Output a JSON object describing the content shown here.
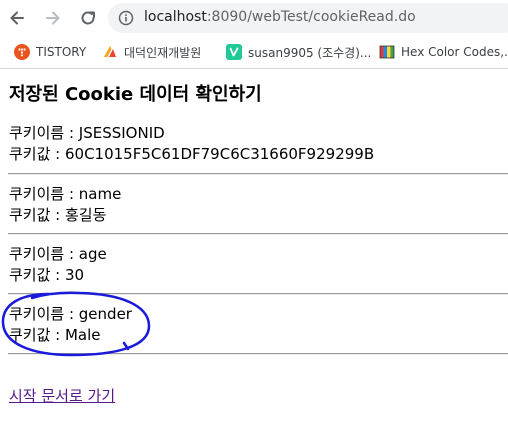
{
  "browser": {
    "url_host": "localhost",
    "url_path": ":8090/webTest/cookieRead.do",
    "bookmarks": [
      {
        "label": "TISTORY",
        "icon": "tistory-icon"
      },
      {
        "label": "대덕인재개발원",
        "icon": "ddit-icon"
      },
      {
        "label": "susan9905 (조수경)...",
        "icon": "velog-icon"
      },
      {
        "label": "Hex Color Codes,...",
        "icon": "hex-color-icon"
      }
    ]
  },
  "page": {
    "title": "저장된 Cookie 데이터 확인하기",
    "cookies": [
      {
        "name_line": "쿠키이름 : JSESSIONID",
        "value_line": "쿠키값 : 60C1015F5C61DF79C6C31660F929299B"
      },
      {
        "name_line": "쿠키이름 : name",
        "value_line": "쿠키값 : 홍길동"
      },
      {
        "name_line": "쿠키이름 : age",
        "value_line": "쿠키값 : 30"
      },
      {
        "name_line": "쿠키이름 : gender",
        "value_line": "쿠키값 : Male"
      }
    ],
    "start_link": "시작 문서로 가기"
  },
  "colors": {
    "link": "#551a8b",
    "annotation": "#1a1adb",
    "omnibox_bg": "#f1f3f4"
  }
}
